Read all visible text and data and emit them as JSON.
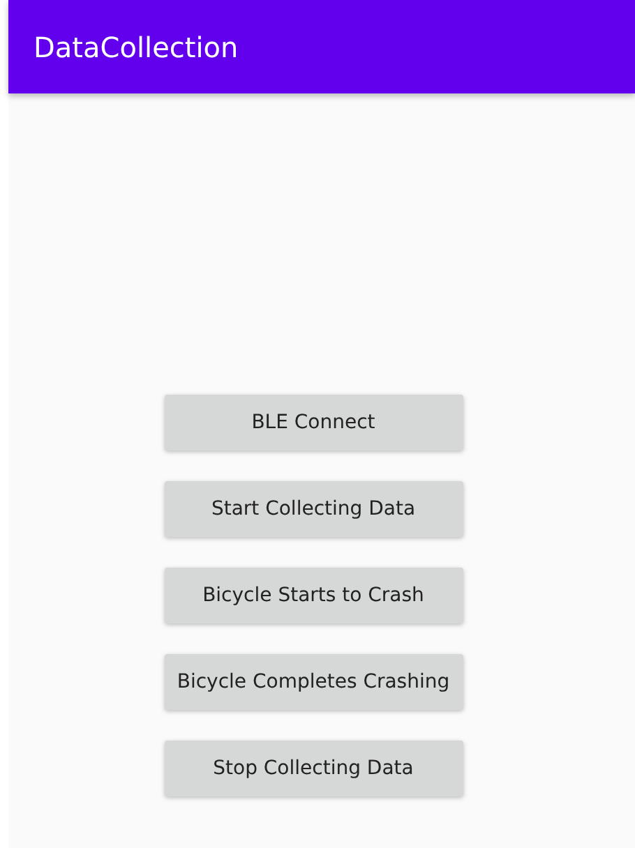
{
  "app_bar": {
    "title": "DataCollection"
  },
  "buttons": [
    {
      "label": "BLE Connect"
    },
    {
      "label": "Start Collecting Data"
    },
    {
      "label": "Bicycle Starts to Crash"
    },
    {
      "label": "Bicycle Completes Crashing"
    },
    {
      "label": "Stop Collecting Data"
    }
  ]
}
